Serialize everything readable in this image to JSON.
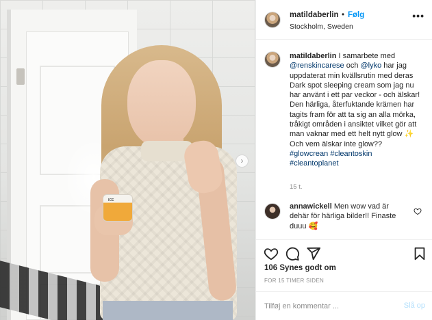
{
  "post": {
    "username": "matildaberlin",
    "separator": "•",
    "follow_label": "Følg",
    "location": "Stockholm, Sweden",
    "more_label": "•••",
    "product_label": "ICE"
  },
  "caption": {
    "username": "matildaberlin",
    "text_1": " I samarbete med ",
    "mention_1": "@renskincarese",
    "text_2": " och ",
    "mention_2": "@lyko",
    "text_3": " har jag uppdaterat min kvällsrutin med deras Dark spot sleeping cream som jag nu har använt i ett par veckor - och älskar!",
    "text_4": "Den härliga, återfuktande krämen har tagits fram för att ta sig an alla mörka, tråkigt områden i ansiktet vilket gör att man vaknar med ett helt nytt glow ",
    "emoji_1": "✨",
    "text_5": " Och vem älskar inte glow??",
    "hashtag_1": "#glowcrean",
    "hashtag_2": "#cleantoskin",
    "hashtag_3": "#cleantoplanet",
    "time": "15 t."
  },
  "comment": {
    "username": "annawickell",
    "text": " Men wow vad är dehär för härliga bilder!! Finaste duuu ",
    "emoji": "🥰"
  },
  "stats": {
    "likes": "106 Synes godt om",
    "age": "FOR 15 TIMER SIDEN"
  },
  "composer": {
    "placeholder": "Tilføj en kommentar ...",
    "post_label": "Slå op"
  },
  "colors": {
    "link": "#0095f6",
    "mention": "#00376b",
    "muted": "#8e8e8e",
    "post_disabled": "#b2dffc"
  }
}
